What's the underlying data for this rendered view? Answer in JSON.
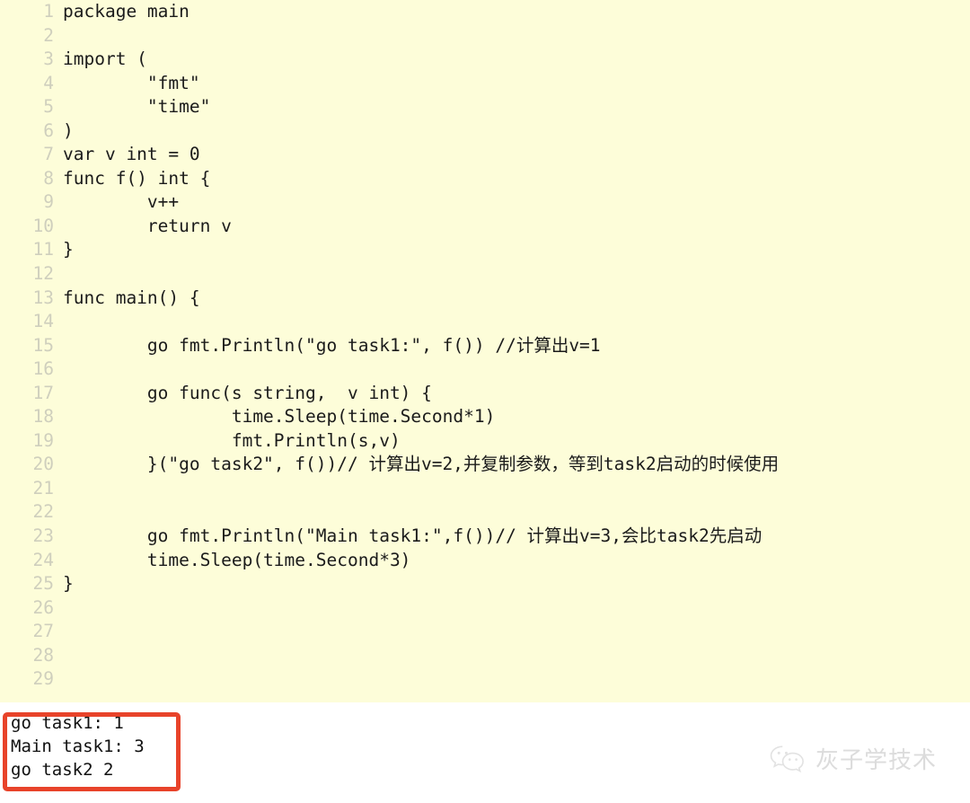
{
  "editor": {
    "language": "Go",
    "background_color": "#fdfdd9",
    "text_color": "#1b1b1b",
    "line_number_color": "#cfcfbd",
    "lines": [
      {
        "n": "1",
        "code": "package main"
      },
      {
        "n": "2",
        "code": ""
      },
      {
        "n": "3",
        "code": "import ("
      },
      {
        "n": "4",
        "code": "        \"fmt\""
      },
      {
        "n": "5",
        "code": "        \"time\""
      },
      {
        "n": "6",
        "code": ")"
      },
      {
        "n": "7",
        "code": "var v int = 0"
      },
      {
        "n": "8",
        "code": "func f() int {"
      },
      {
        "n": "9",
        "code": "        v++"
      },
      {
        "n": "10",
        "code": "        return v"
      },
      {
        "n": "11",
        "code": "}"
      },
      {
        "n": "12",
        "code": ""
      },
      {
        "n": "13",
        "code": "func main() {"
      },
      {
        "n": "14",
        "code": ""
      },
      {
        "n": "15",
        "code": "        go fmt.Println(\"go task1:\", f()) //计算出v=1"
      },
      {
        "n": "16",
        "code": ""
      },
      {
        "n": "17",
        "code": "        go func(s string,  v int) {"
      },
      {
        "n": "18",
        "code": "                time.Sleep(time.Second*1)"
      },
      {
        "n": "19",
        "code": "                fmt.Println(s,v)"
      },
      {
        "n": "20",
        "code": "        }(\"go task2\", f())// 计算出v=2,并复制参数，等到task2启动的时候使用"
      },
      {
        "n": "21",
        "code": ""
      },
      {
        "n": "22",
        "code": ""
      },
      {
        "n": "23",
        "code": "        go fmt.Println(\"Main task1:\",f())// 计算出v=3,会比task2先启动"
      },
      {
        "n": "24",
        "code": "        time.Sleep(time.Second*3)"
      },
      {
        "n": "25",
        "code": "}"
      },
      {
        "n": "26",
        "code": ""
      },
      {
        "n": "27",
        "code": ""
      },
      {
        "n": "28",
        "code": ""
      },
      {
        "n": "29",
        "code": ""
      }
    ]
  },
  "output": {
    "border_color": "#e8432a",
    "background_color": "#ffffff",
    "lines": [
      "go task1: 1",
      "Main task1: 3",
      "go task2 2"
    ]
  },
  "watermark": {
    "icon": "wechat-logo-icon",
    "text": "灰子学技术",
    "color": "#dcdcdc"
  }
}
